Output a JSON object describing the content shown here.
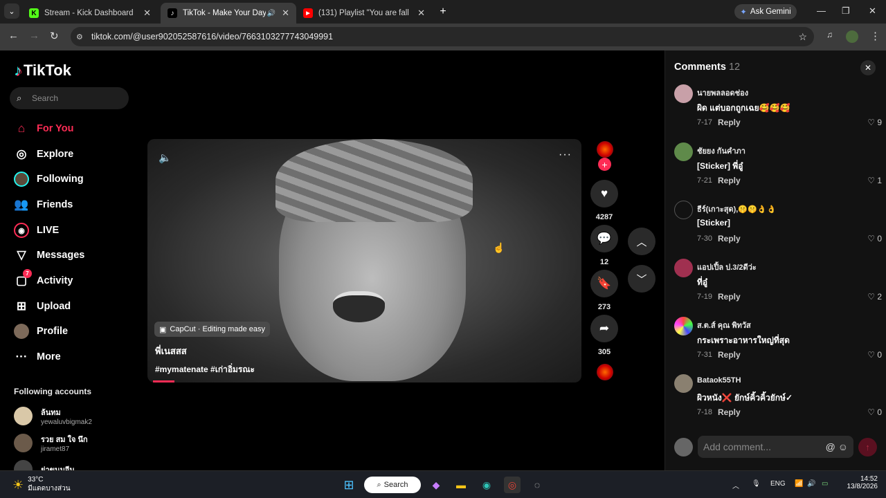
{
  "browser": {
    "tabs": [
      {
        "title": "Stream - Kick Dashboard",
        "favicon": "K",
        "color": "#53fc18",
        "active": false
      },
      {
        "title": "TikTok - Make Your Day",
        "favicon": "♪",
        "color": "#000000",
        "active": true
      },
      {
        "title": "(131) Playlist \"You are fall",
        "favicon": "▶",
        "color": "#ff0000",
        "active": false
      }
    ],
    "url": "tiktok.com/@user902052587616/video/7663103277743049991",
    "gemini_label": "Ask Gemini"
  },
  "sidebar": {
    "logo": "TikTok",
    "search_placeholder": "Search",
    "nav": [
      {
        "label": "For You",
        "icon": "home-icon",
        "active": true
      },
      {
        "label": "Explore",
        "icon": "compass-icon"
      },
      {
        "label": "Following",
        "icon": "following-avatar-icon"
      },
      {
        "label": "Friends",
        "icon": "friends-icon"
      },
      {
        "label": "LIVE",
        "icon": "live-icon"
      },
      {
        "label": "Messages",
        "icon": "send-icon"
      },
      {
        "label": "Activity",
        "icon": "activity-icon",
        "badge": "7"
      },
      {
        "label": "Upload",
        "icon": "plus-square-icon"
      },
      {
        "label": "Profile",
        "icon": "profile-avatar-icon"
      },
      {
        "label": "More",
        "icon": "more-icon"
      }
    ],
    "following_title": "Following accounts",
    "following": [
      {
        "name": "ล้นทม",
        "username": "yewaluvbigmak2"
      },
      {
        "name": "รวย สม ใจ นึก",
        "username": "jiramet87"
      },
      {
        "name": "ย่าขนมจีน",
        "username": ""
      }
    ]
  },
  "video": {
    "capcut": "CapCut · Editing made easy",
    "title": "พี่เนสสส",
    "tags": "#mymatenate #เก่าอิ่มรณะ",
    "progress": 0.05
  },
  "actions": {
    "likes": "4287",
    "comments": "12",
    "saves": "273",
    "shares": "305"
  },
  "comments_panel": {
    "title": "Comments",
    "count": "12",
    "items": [
      {
        "user": "นายพลลอดช่อง",
        "text": "ผิด แต่บอกถูกเฉย🥰🥰🥰",
        "date": "7-17",
        "reply": "Reply",
        "likes": "9"
      },
      {
        "user": "ชัยยง กันคำภา",
        "text": "[Sticker] พี่อู๋",
        "date": "7-21",
        "reply": "Reply",
        "likes": "1"
      },
      {
        "user": "ธีร์(เกาะสุด),🤫🤫👌👌",
        "text": "[Sticker]",
        "date": "7-30",
        "reply": "Reply",
        "likes": "0"
      },
      {
        "user": "แอปเปิ้ล ป.3/2ดีว่ะ",
        "text": "ที่อู๋",
        "date": "7-19",
        "reply": "Reply",
        "likes": "2"
      },
      {
        "user": "ส.ต.ส์ คุณ พิทวัส",
        "text": "กระเพราะอาหารใหญ่ที่สุด",
        "date": "7-31",
        "reply": "Reply",
        "likes": "0"
      },
      {
        "user": "Bataok55TH",
        "text": "ผิวหนัง❌ ยักษ์คิ้วคิ้วยักษ์✓",
        "date": "7-18",
        "reply": "Reply",
        "likes": "0"
      }
    ],
    "add_placeholder": "Add comment..."
  },
  "taskbar": {
    "temp": "33°C",
    "weather": "มีแดดบางส่วน",
    "search": "Search",
    "lang": "ENG",
    "time": "14:52",
    "date": "13/8/2026"
  }
}
